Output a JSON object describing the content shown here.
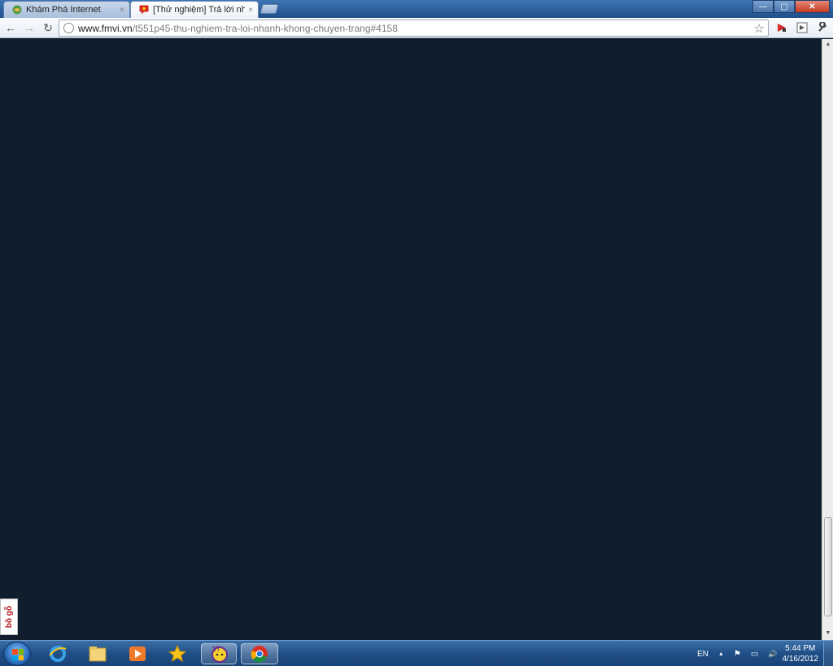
{
  "browser": {
    "tabs": [
      {
        "title": "Khám Phá Internet",
        "close": "×",
        "icon": "globe-icon"
      },
      {
        "title": "[Thử nghiệm] Trả lời nhanh",
        "close": "×",
        "icon": "chat-icon"
      }
    ],
    "url_host": "www.fmvi.vn",
    "url_path": "/t551p45-thu-nghiem-tra-loi-nhanh-khong-chuyen-trang#4158",
    "bookmark_star": "☆",
    "window_controls": {
      "minimize": "—",
      "maximize": "▢",
      "close": "✕"
    },
    "nav": {
      "back": "←",
      "forward": "→",
      "reload": "↻"
    },
    "extensions": [
      "flag-extension-icon",
      "page-extension-icon",
      "wrench-icon"
    ]
  },
  "page": {
    "background": "#0f1d2d",
    "side_widget_label": "bồ gỗ"
  },
  "taskbar": {
    "pinned": [
      "windows-start-icon",
      "internet-explorer-icon",
      "file-explorer-icon",
      "media-player-icon",
      "favorites-star-icon",
      "yahoo-messenger-icon",
      "chrome-icon"
    ],
    "language": "EN",
    "time": "5:44 PM",
    "date": "4/16/2012",
    "tray_arrow": "▲",
    "tray_flag": "⚑",
    "tray_network": "▭",
    "tray_volume": "🔊"
  }
}
